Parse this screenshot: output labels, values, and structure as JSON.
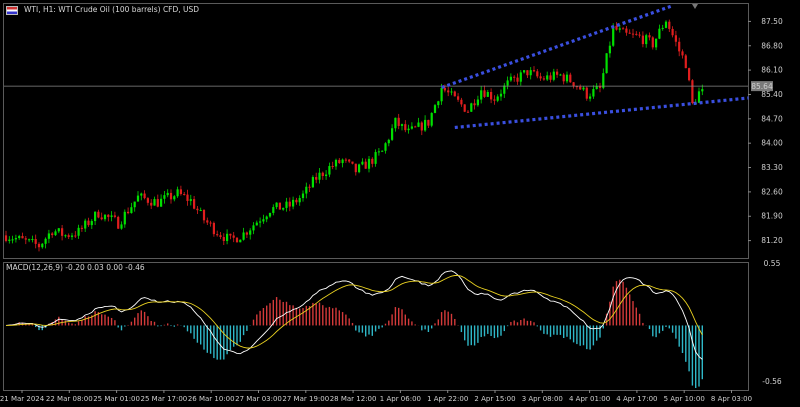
{
  "header": {
    "title": "WTI, H1:  WTI Crude Oil (100 barrels) CFD, USD",
    "icon": "symbol-flag-icon"
  },
  "macd": {
    "label": "MACD(12,26,9) -0.20 0.03 0.00 -0.46",
    "axis_labels": [
      "0.55",
      "-0.56"
    ]
  },
  "price_axis": {
    "labels": [
      "87.50",
      "86.80",
      "86.10",
      "85.40",
      "84.70",
      "84.00",
      "83.30",
      "82.60",
      "81.90",
      "81.20"
    ],
    "current_price": "85.64"
  },
  "time_axis": {
    "labels": [
      "21 Mar 2024",
      "22 Mar 08:00",
      "25 Mar 01:00",
      "25 Mar 17:00",
      "26 Mar 10:00",
      "27 Mar 03:00",
      "27 Mar 19:00",
      "28 Mar 12:00",
      "1 Apr 06:00",
      "1 Apr 22:00",
      "2 Apr 15:00",
      "3 Apr 08:00",
      "4 Apr 01:00",
      "4 Apr 17:00",
      "5 Apr 10:00",
      "8 Apr 03:00"
    ]
  },
  "colors": {
    "bull": "#00e000",
    "bear": "#e01e1e",
    "trendline": "#3a4fe0",
    "macd_pos": "#d43a3a",
    "macd_neg": "#2fb8c8",
    "main_line": "#ffffff",
    "signal_line": "#e8d020"
  },
  "chart_data": {
    "type": "candlestick",
    "y_range": [
      80.7,
      88.0
    ],
    "anchors": [
      [
        0,
        81.35
      ],
      [
        10,
        81.05
      ],
      [
        14,
        81.5
      ],
      [
        18,
        81.35
      ],
      [
        22,
        81.45
      ],
      [
        28,
        82.0
      ],
      [
        34,
        81.7
      ],
      [
        40,
        82.45
      ],
      [
        46,
        82.3
      ],
      [
        52,
        82.55
      ],
      [
        56,
        82.35
      ],
      [
        60,
        81.8
      ],
      [
        64,
        81.45
      ],
      [
        68,
        81.2
      ],
      [
        72,
        81.4
      ],
      [
        76,
        81.75
      ],
      [
        80,
        82.1
      ],
      [
        86,
        82.2
      ],
      [
        90,
        82.5
      ],
      [
        94,
        83.0
      ],
      [
        98,
        83.3
      ],
      [
        102,
        83.5
      ],
      [
        106,
        83.2
      ],
      [
        110,
        83.45
      ],
      [
        114,
        83.75
      ],
      [
        118,
        84.6
      ],
      [
        122,
        84.3
      ],
      [
        128,
        84.6
      ],
      [
        132,
        85.6
      ],
      [
        136,
        85.25
      ],
      [
        140,
        84.95
      ],
      [
        144,
        85.55
      ],
      [
        148,
        85.3
      ],
      [
        152,
        85.7
      ],
      [
        158,
        86.05
      ],
      [
        162,
        85.85
      ],
      [
        168,
        85.95
      ],
      [
        172,
        85.75
      ],
      [
        176,
        85.4
      ],
      [
        180,
        85.55
      ],
      [
        184,
        87.3
      ],
      [
        188,
        87.1
      ],
      [
        192,
        87.05
      ],
      [
        196,
        86.85
      ],
      [
        200,
        87.55
      ],
      [
        202,
        87.1
      ],
      [
        204,
        86.65
      ],
      [
        206,
        86.3
      ],
      [
        208,
        85.1
      ],
      [
        210,
        85.45
      ]
    ],
    "trendlines": [
      {
        "from": [
          132,
          85.6
        ],
        "to": [
          202,
          87.95
        ]
      },
      {
        "from": [
          136,
          84.45
        ],
        "to": [
          225,
          85.3
        ]
      }
    ],
    "macd_range": [
      -0.56,
      0.55
    ]
  }
}
